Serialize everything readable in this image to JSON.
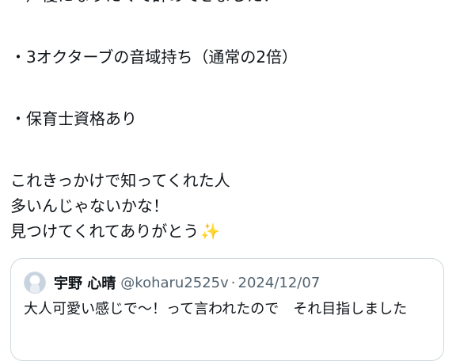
{
  "tweet": {
    "lines": [
      "・声優になりたくて辞めてきました！",
      "・3オクターブの音域持ち（通常の2倍）",
      "・保育士資格あり",
      "これきっかけで知ってくれた人",
      "多いんじゃないかな！",
      "見つけてくれてありがとう"
    ],
    "sparkles_emoji": "✨"
  },
  "quote": {
    "name": "宇野 心晴",
    "handle": "@koharu2525v",
    "separator": "·",
    "date": "2024/12/07",
    "text": "大人可愛い感じで〜！って言われたので　それ目指しました"
  },
  "colors": {
    "text": "#0f1419",
    "secondary": "#536471",
    "border": "#cfd9de",
    "sparkles": "#f4c542"
  }
}
